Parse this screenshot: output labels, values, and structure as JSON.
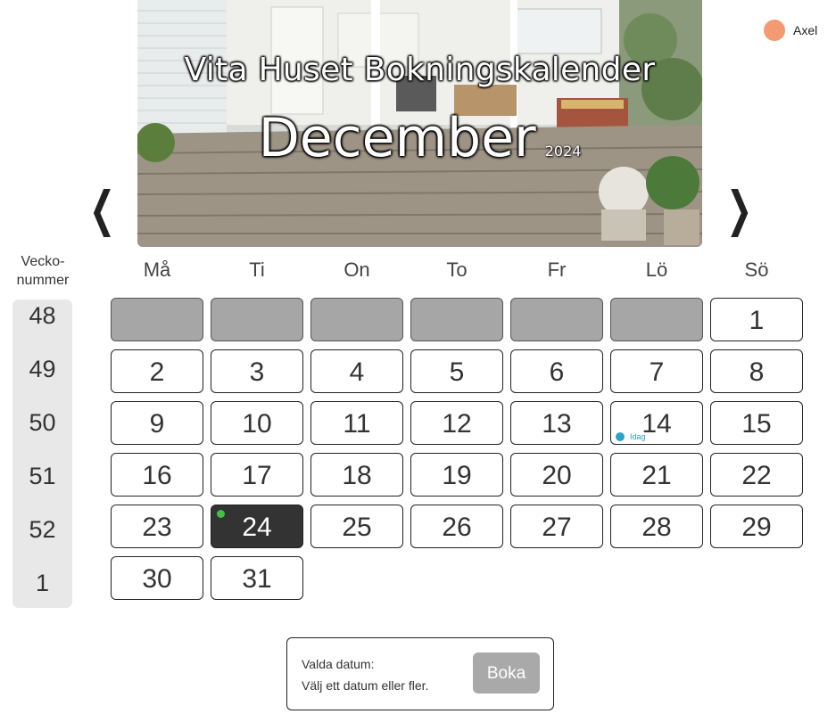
{
  "header": {
    "title": "Vita Huset Bokningskalender",
    "month": "December",
    "year": "2024",
    "prev_arrow": "❮",
    "next_arrow": "❯"
  },
  "user": {
    "name": "Axel",
    "color": "#f49a72"
  },
  "week_header": {
    "line1": "Vecko-",
    "line2": "nummer"
  },
  "week_numbers": [
    "48",
    "49",
    "50",
    "51",
    "52",
    "1"
  ],
  "weekdays": [
    "Må",
    "Ti",
    "On",
    "To",
    "Fr",
    "Lö",
    "Sö"
  ],
  "days": [
    "",
    "",
    "",
    "",
    "",
    "",
    "1",
    "2",
    "3",
    "4",
    "5",
    "6",
    "7",
    "8",
    "9",
    "10",
    "11",
    "12",
    "13",
    "14",
    "15",
    "16",
    "17",
    "18",
    "19",
    "20",
    "21",
    "22",
    "23",
    "24",
    "25",
    "26",
    "27",
    "28",
    "29",
    "30",
    "31"
  ],
  "today": {
    "day": "14",
    "label": "Idag",
    "color": "#2aa3c9"
  },
  "selected_day": "24",
  "booking": {
    "label": "Valda datum:",
    "hint": "Välj ett datum eller fler.",
    "button": "Boka"
  }
}
